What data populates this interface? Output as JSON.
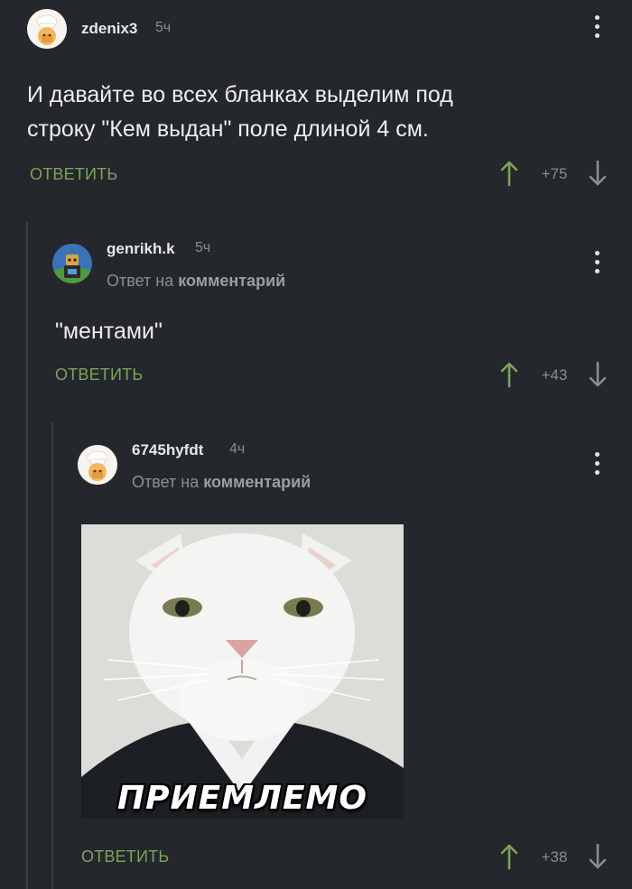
{
  "comments": [
    {
      "username": "zdenix3",
      "time": "5ч",
      "text_lines": [
        "И давайте во всех бланках выделим под",
        "строку \"Кем выдан\" поле длиной 4 см."
      ],
      "reply_label": "ОТВЕТИТЬ",
      "rating": "+75"
    },
    {
      "username": "genrikh.k",
      "time": "5ч",
      "reply_to_prefix": "Ответ на",
      "reply_to_link": "комментарий",
      "text": "\"ментами\"",
      "reply_label": "ОТВЕТИТЬ",
      "rating": "+43"
    },
    {
      "username": "6745hyfdt",
      "time": "4ч",
      "reply_to_prefix": "Ответ на",
      "reply_to_link": "комментарий",
      "image_caption": "ПРИЕМЛЕМО",
      "reply_label": "ОТВЕТИТЬ",
      "rating": "+38"
    }
  ],
  "colors": {
    "background": "#24272c",
    "reply_green": "#7ea35a",
    "muted": "#8a8d91",
    "thread_line": "#3b3e43"
  },
  "icons": {
    "menu": "kebab-icon",
    "upvote": "arrow-up-icon",
    "downvote": "arrow-down-icon",
    "avatar": "chef-avatar"
  }
}
